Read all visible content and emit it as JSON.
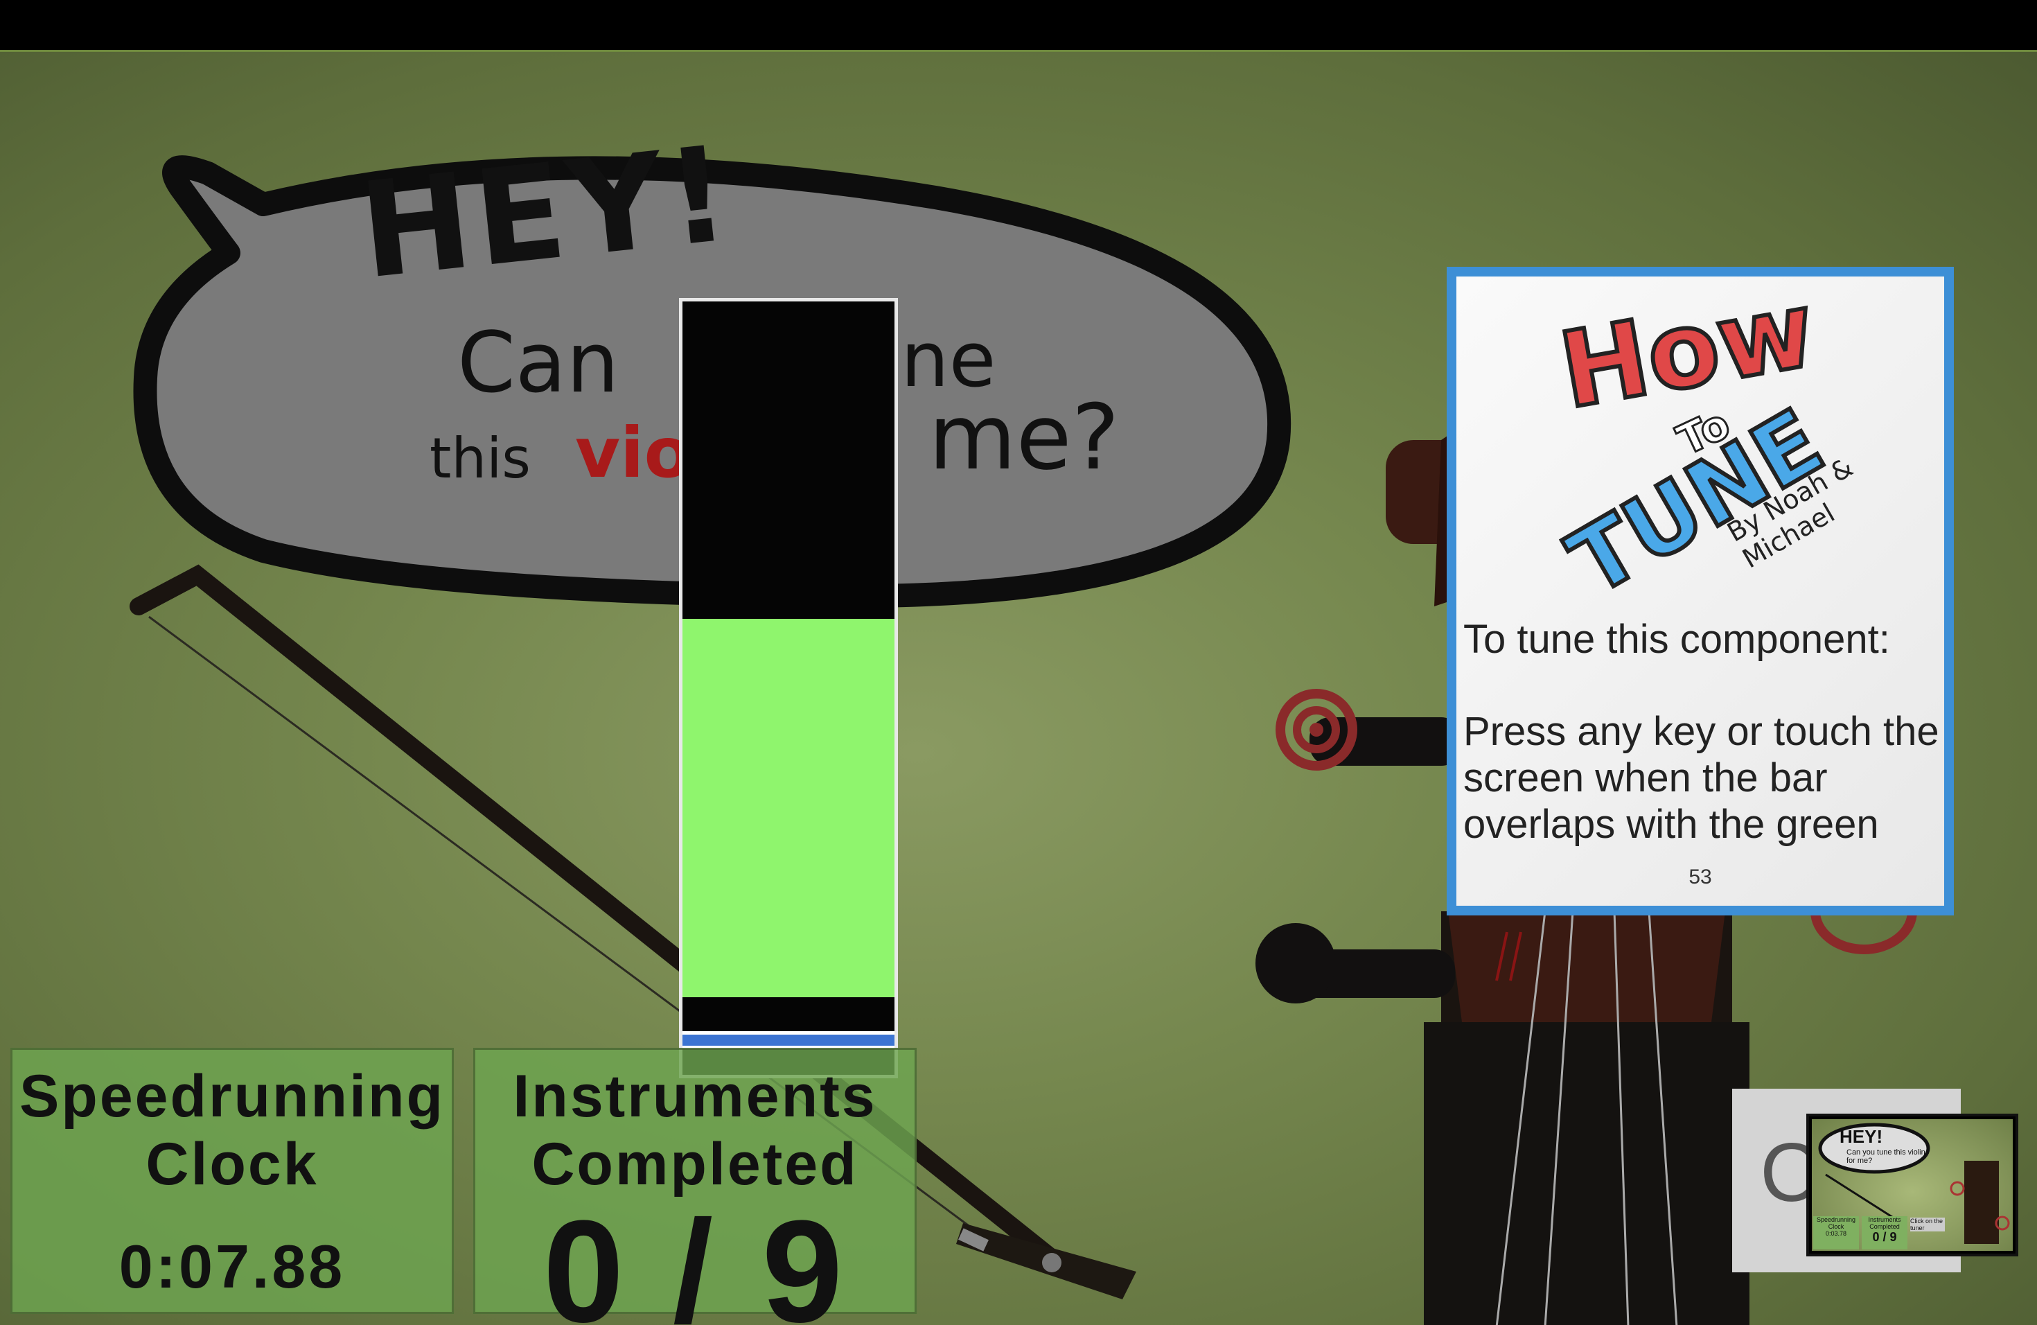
{
  "speech_bubble": {
    "line_hey": "HEY!",
    "line_can": "Can",
    "line_ne": "ne",
    "line_me": "me?",
    "line_this": "this",
    "line_vio": "vio"
  },
  "tuning_meter": {
    "cursor_position": 0.955,
    "green_zone": [
      0.41,
      0.9
    ]
  },
  "speedrun_panel": {
    "title": "Speedrunning Clock",
    "time": "0:07.88"
  },
  "instruments_panel": {
    "title": "Instruments Completed",
    "count": "0 / 9"
  },
  "howto_card": {
    "title_how": "How",
    "title_to": "To",
    "title_tune": "TUNE",
    "credits": "By Noah & Michael",
    "instruction_heading": "To tune this component:",
    "instruction_body": "Press any key or touch the screen when the bar overlaps with the green",
    "page_number": "53"
  },
  "thumbnail": {
    "letter": "C",
    "hey": "HEY!",
    "subtitle": "Can you tune this violin for me?",
    "clock_label": "Speedrunning Clock",
    "clock_value": "0:03.78",
    "completed_label": "Instruments Completed",
    "completed_value": "0 / 9",
    "hint": "Click on the tuner"
  },
  "colors": {
    "background": "#75874e",
    "meter_green": "#8ff56d",
    "meter_cursor": "#3c74d2",
    "card_border": "#3d8fd6",
    "how_red": "#e04848",
    "tune_blue": "#4aa8e8",
    "violin_red": "#a81a1a"
  }
}
